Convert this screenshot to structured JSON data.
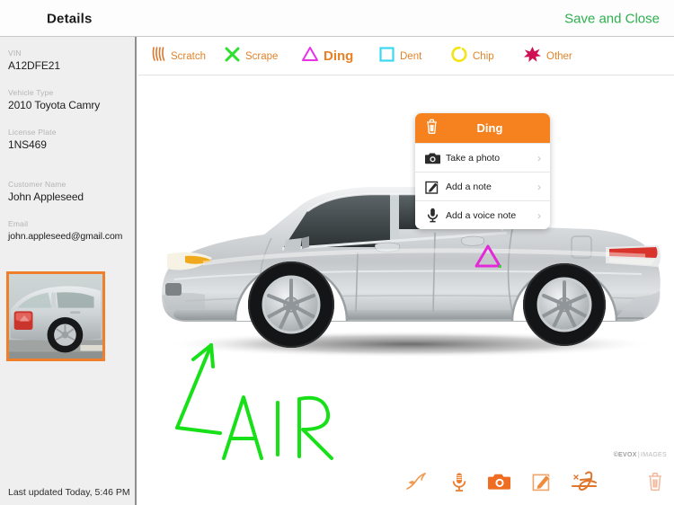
{
  "header": {
    "title": "Details",
    "action_label": "Save and Close"
  },
  "sidebar": {
    "fields": [
      {
        "label": "VIN",
        "value": "A12DFE21"
      },
      {
        "label": "Vehicle Type",
        "value": "2010 Toyota Camry"
      },
      {
        "label": "License Plate",
        "value": "1NS469"
      },
      {
        "label": "Customer Name",
        "value": "John Appleseed"
      },
      {
        "label": "Email",
        "value": "john.appleseed@gmail.com"
      }
    ],
    "thumbnail_name": "vehicle-damage-photo-thumbnail",
    "last_updated": "Last updated Today, 5:46 PM"
  },
  "damage_types": [
    {
      "label": "Scratch",
      "icon": "scratch-icon",
      "color": "#d9772e",
      "selected": false
    },
    {
      "label": "Scrape",
      "icon": "scrape-icon",
      "color": "#2ee02e",
      "selected": false
    },
    {
      "label": "Ding",
      "icon": "ding-icon",
      "color": "#e832e8",
      "selected": true
    },
    {
      "label": "Dent",
      "icon": "dent-icon",
      "color": "#3cd8f0",
      "selected": false
    },
    {
      "label": "Chip",
      "icon": "chip-icon",
      "color": "#f2e513",
      "selected": false
    },
    {
      "label": "Other",
      "icon": "other-icon",
      "color": "#cf1054",
      "selected": false
    }
  ],
  "canvas": {
    "marker": {
      "type": "ding-marker",
      "color": "#e22ad8"
    },
    "sketch": {
      "text": "AIR",
      "color": "#18e018"
    },
    "watermark": {
      "brand": "©EVOX",
      "suffix": "IMAGES"
    }
  },
  "popup": {
    "title": "Ding",
    "accent": "#f5821f",
    "delete_icon": "trash-icon",
    "rows": [
      {
        "label": "Take a photo",
        "icon": "camera-icon"
      },
      {
        "label": "Add a note",
        "icon": "note-pencil-icon"
      },
      {
        "label": "Add a voice note",
        "icon": "microphone-icon"
      }
    ],
    "chevron": "›"
  },
  "bottom_toolbar": {
    "items": [
      {
        "name": "draw-pen-icon",
        "label": "Draw"
      },
      {
        "name": "microphone-icon",
        "label": "Voice note"
      },
      {
        "name": "camera-icon",
        "label": "Photo"
      },
      {
        "name": "note-pencil-icon",
        "label": "Note"
      },
      {
        "name": "signature-icon",
        "label": "Signature"
      },
      {
        "name": "trash-icon",
        "label": "Delete"
      }
    ]
  }
}
